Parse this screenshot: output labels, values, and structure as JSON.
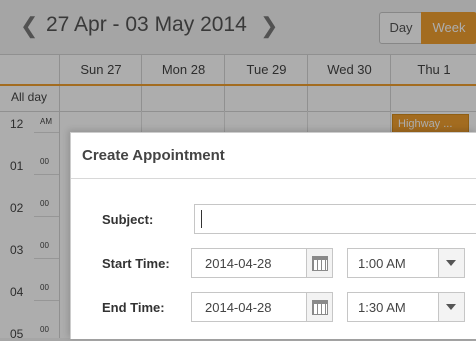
{
  "toolbar": {
    "prev_glyph": "❮",
    "next_glyph": "❯",
    "date_range": "27 Apr - 03 May 2014",
    "view_day": "Day",
    "view_week": "Week",
    "accent_color": "#f0a030"
  },
  "days": [
    "Sun 27",
    "Mon 28",
    "Tue 29",
    "Wed 30",
    "Thu 1"
  ],
  "allday_label": "All day",
  "hours": [
    {
      "label": "12",
      "sub": "AM"
    },
    {
      "label": "01",
      "sub": "00"
    },
    {
      "label": "02",
      "sub": "00"
    },
    {
      "label": "03",
      "sub": "00"
    },
    {
      "label": "04",
      "sub": "00"
    },
    {
      "label": "05",
      "sub": "00"
    }
  ],
  "event": {
    "title": "Highway ..."
  },
  "dialog": {
    "title": "Create Appointment",
    "subject_label": "Subject:",
    "subject_value": "",
    "start_label": "Start Time:",
    "start_date": "2014-04-28",
    "start_time": "1:00 AM",
    "end_label": "End Time:",
    "end_date": "2014-04-28",
    "end_time": "1:30 AM"
  }
}
